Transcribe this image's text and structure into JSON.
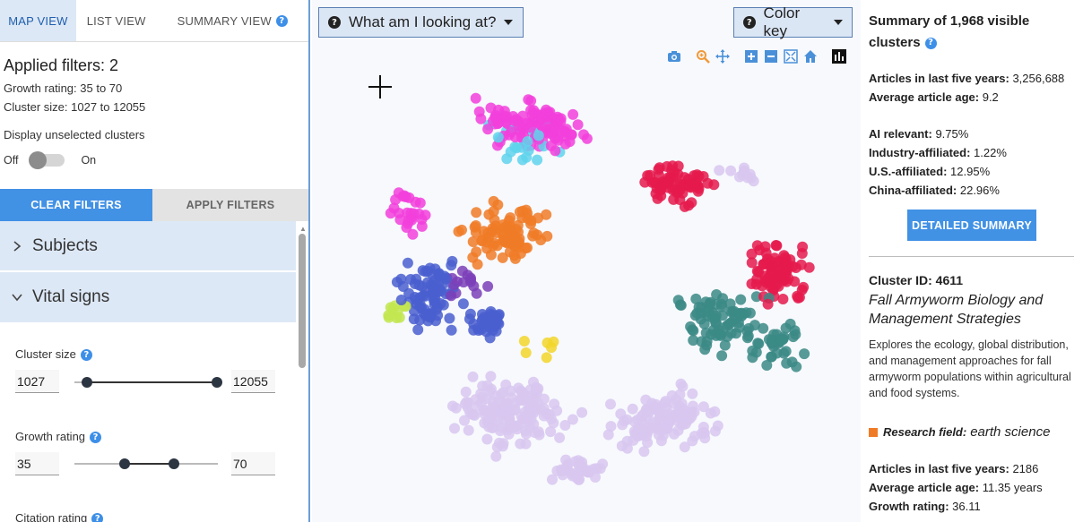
{
  "tabs": [
    {
      "label": "MAP VIEW",
      "active": true
    },
    {
      "label": "LIST VIEW",
      "active": false
    },
    {
      "label": "SUMMARY VIEW",
      "active": false
    }
  ],
  "filters": {
    "applied_title": "Applied filters: 2",
    "lines": [
      "Growth rating: 35 to 70",
      "Cluster size: 1027 to 12055"
    ],
    "display_unselected": "Display unselected clusters",
    "toggle_off": "Off",
    "toggle_on": "On",
    "toggle_state": false,
    "clear_label": "CLEAR FILTERS",
    "apply_label": "APPLY FILTERS"
  },
  "accordion": {
    "subjects": "Subjects",
    "vital_signs": "Vital signs"
  },
  "vital": {
    "cluster_size": {
      "label": "Cluster size",
      "min": "1027",
      "max": "12055"
    },
    "growth_rating": {
      "label": "Growth rating",
      "min": "35",
      "max": "70"
    },
    "citation_rating": {
      "label": "Citation rating"
    }
  },
  "map": {
    "looking_label": "What am I looking at?",
    "color_key_label": "Color key",
    "palette": [
      "#f23fdc",
      "#f07b27",
      "#e51a4c",
      "#3b8a86",
      "#4a5fcf",
      "#d8c7f0",
      "#5fd4ec",
      "#c2e64f",
      "#f2d62a",
      "#7b3fb8"
    ]
  },
  "summary": {
    "title": "Summary of 1,968 visible clusters",
    "articles_label": "Articles in last five years:",
    "articles_value": "3,256,688",
    "avg_age_label": "Average article age:",
    "avg_age_value": "9.2",
    "ai_label": "AI relevant:",
    "ai_value": "9.75%",
    "industry_label": "Industry-affiliated:",
    "industry_value": "1.22%",
    "us_label": "U.S.-affiliated:",
    "us_value": "12.95%",
    "china_label": "China-affiliated:",
    "china_value": "22.96%",
    "detailed_label": "DETAILED SUMMARY"
  },
  "cluster": {
    "id": "Cluster ID: 4611",
    "name": "Fall Armyworm Biology and Management Strategies",
    "description": "Explores the ecology, global distribution, and management approaches for fall armyworm populations within agricultural and food systems.",
    "field_label": "Research field:",
    "field_value": "earth science",
    "field_color": "#f07b27",
    "articles_label": "Articles in last five years:",
    "articles_value": "2186",
    "avg_age_label": "Average article age:",
    "avg_age_value": "11.35 years",
    "growth_label": "Growth rating:",
    "growth_value": "36.11"
  }
}
